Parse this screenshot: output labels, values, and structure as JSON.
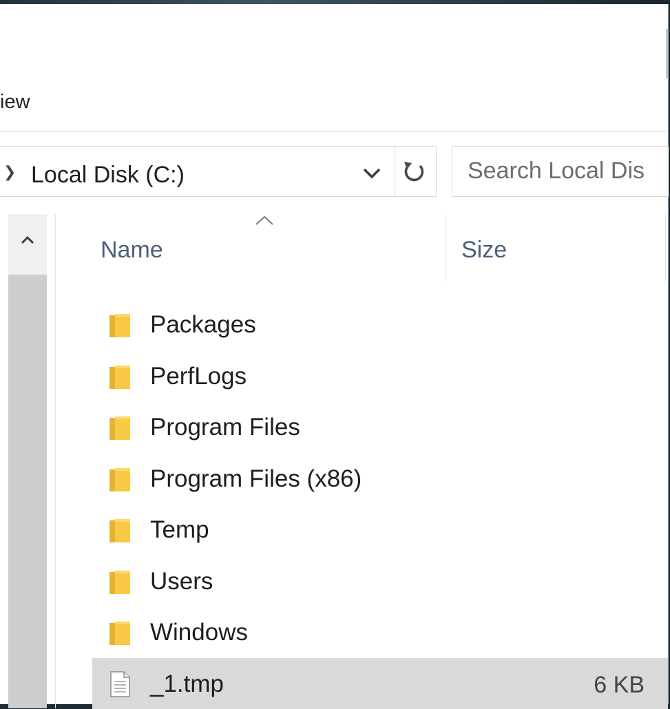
{
  "ribbon": {
    "view_tab_label": "iew"
  },
  "address_bar": {
    "path_label": "Local Disk (C:)"
  },
  "search": {
    "placeholder": "Search Local Dis"
  },
  "columns": {
    "name_label": "Name",
    "size_label": "Size",
    "sorted_by": "Name"
  },
  "files": [
    {
      "name": "Packages",
      "type": "folder",
      "size": "",
      "selected": false
    },
    {
      "name": "PerfLogs",
      "type": "folder",
      "size": "",
      "selected": false
    },
    {
      "name": "Program Files",
      "type": "folder",
      "size": "",
      "selected": false
    },
    {
      "name": "Program Files (x86)",
      "type": "folder",
      "size": "",
      "selected": false
    },
    {
      "name": "Temp",
      "type": "folder",
      "size": "",
      "selected": false
    },
    {
      "name": "Users",
      "type": "folder",
      "size": "",
      "selected": false
    },
    {
      "name": "Windows",
      "type": "folder",
      "size": "",
      "selected": false
    },
    {
      "name": "_1.tmp",
      "type": "file",
      "size": "6 KB",
      "selected": true
    }
  ],
  "icons": {
    "folder": "folder-icon",
    "file": "file-icon",
    "breadcrumb": "chevron-right-icon",
    "dropdown": "chevron-down-icon",
    "refresh": "refresh-icon",
    "sort": "sort-ascending-icon",
    "scroll_up": "scroll-up-icon"
  },
  "colors": {
    "folder": "#f8c945",
    "header_text": "#4c607a",
    "selection": "#d9d9d9"
  }
}
